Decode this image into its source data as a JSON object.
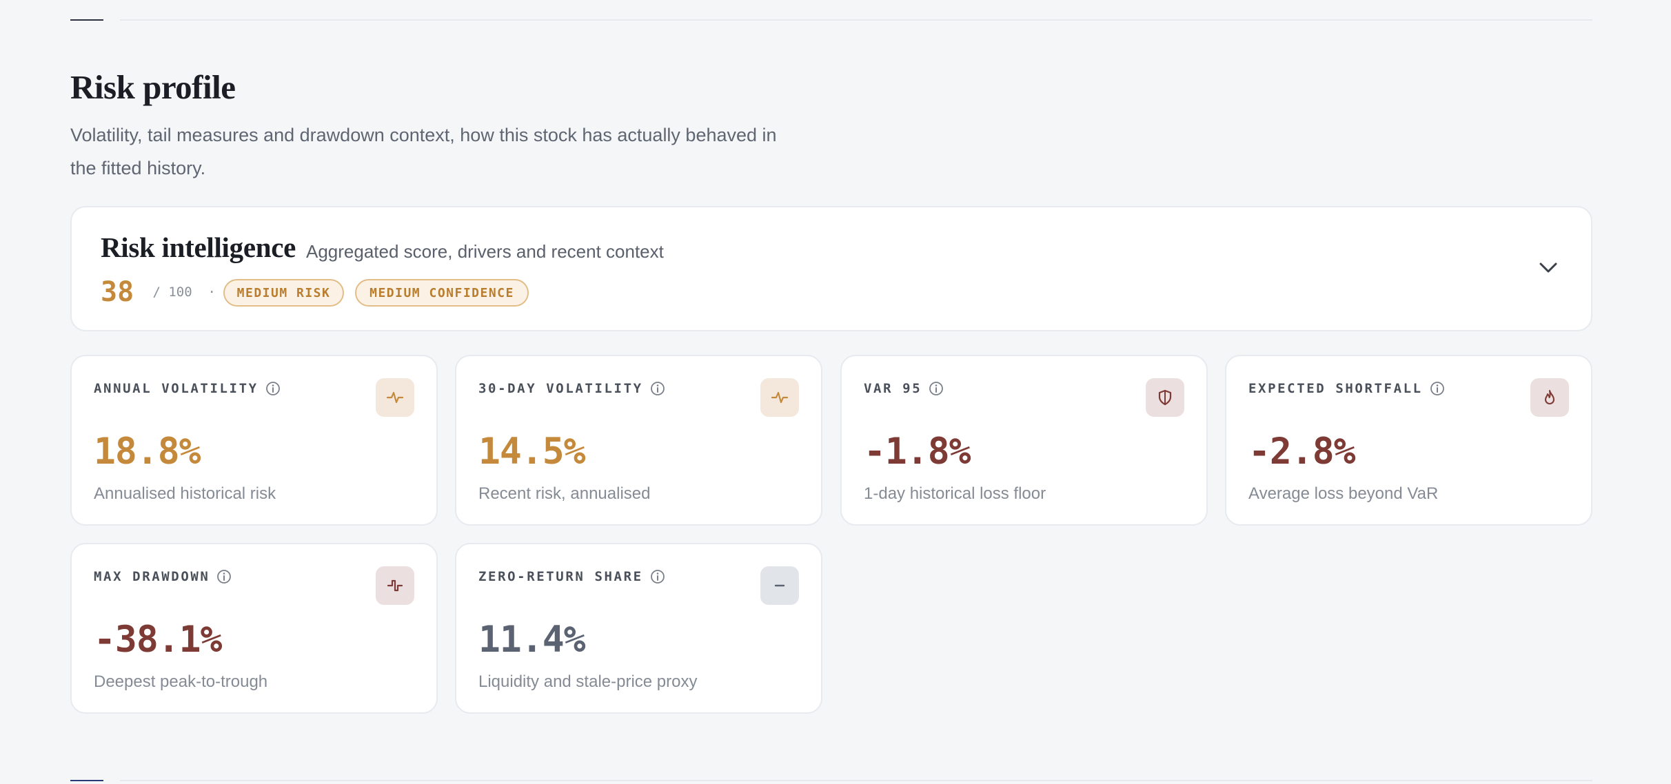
{
  "section": {
    "title": "Risk profile",
    "subtitle": "Volatility, tail measures and drawdown context, how this stock has actually behaved in the fitted history."
  },
  "risk_intelligence": {
    "title": "Risk intelligence",
    "description": "Aggregated score, drivers and recent context",
    "score": "38",
    "out_of": " / 100  ·",
    "risk_badge": "MEDIUM RISK",
    "confidence_badge": "MEDIUM CONFIDENCE",
    "expand_icon": "chevron-down-icon",
    "accent_color": "#c4893a"
  },
  "metrics": [
    {
      "label": "ANNUAL VOLATILITY",
      "value": "18.8%",
      "description": "Annualised historical risk",
      "icon": "pulse-icon",
      "tone": "amber"
    },
    {
      "label": "30-DAY VOLATILITY",
      "value": "14.5%",
      "description": "Recent risk, annualised",
      "icon": "pulse-icon",
      "tone": "amber"
    },
    {
      "label": "VAR 95",
      "value": "-1.8%",
      "description": "1-day historical loss floor",
      "icon": "shield-icon",
      "tone": "red"
    },
    {
      "label": "EXPECTED SHORTFALL",
      "value": "-2.8%",
      "description": "Average loss beyond VaR",
      "icon": "flame-icon",
      "tone": "red"
    },
    {
      "label": "MAX DRAWDOWN",
      "value": "-38.1%",
      "description": "Deepest peak-to-trough",
      "icon": "drawdown-icon",
      "tone": "red"
    },
    {
      "label": "ZERO-RETURN SHARE",
      "value": "11.4%",
      "description": "Liquidity and stale-price proxy",
      "icon": "minus-icon",
      "tone": "grey"
    }
  ],
  "colors": {
    "amber": "#c4893a",
    "red": "#7e3a34",
    "grey": "#5b6272",
    "background": "#f4f6f8"
  }
}
